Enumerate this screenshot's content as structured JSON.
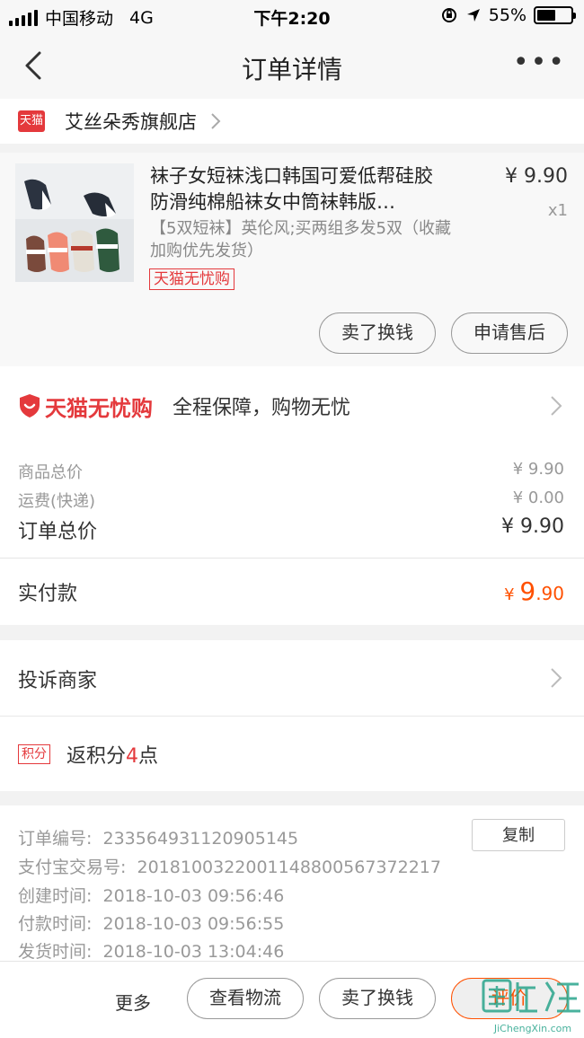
{
  "status_bar": {
    "carrier": "中国移动",
    "network": "4G",
    "time": "下午2:20",
    "battery": "55%"
  },
  "header": {
    "title": "订单详情"
  },
  "store": {
    "badge": "天猫",
    "name": "艾丝朵秀旗舰店"
  },
  "product": {
    "title": "袜子女短袜浅口韩国可爱低帮硅胶防滑纯棉船袜女中筒袜韩版…",
    "price": "¥ 9.90",
    "quantity": "x1",
    "sku": "【5双短袜】英伦风;买两组多发5双（收藏加购优先发货）",
    "tag": "天猫无忧购",
    "buttons": {
      "sell": "卖了换钱",
      "after_sale": "申请售后"
    }
  },
  "guarantee": {
    "logo_text": "天猫无忧购",
    "text": "全程保障，购物无忧"
  },
  "summary": {
    "goods_total_label": "商品总价",
    "goods_total": "¥ 9.90",
    "shipping_label": "运费(快递)",
    "shipping": "¥ 0.00",
    "order_total_label": "订单总价",
    "order_total": "¥ 9.90",
    "paid_label": "实付款",
    "paid_currency": "¥ ",
    "paid_int": "9",
    "paid_dec": ".90"
  },
  "complain": {
    "label": "投诉商家"
  },
  "points": {
    "badge": "积分",
    "prefix": "返积分",
    "count": "4",
    "suffix": "点"
  },
  "order_info": {
    "order_no_label": "订单编号:",
    "order_no": "233564931120905145",
    "copy_label": "复制",
    "alipay_label": "支付宝交易号:",
    "alipay_no": "2018100322001148800567372217",
    "created_label": "创建时间:",
    "created": "2018-10-03 09:56:46",
    "paid_time_label": "付款时间:",
    "paid_time": "2018-10-03 09:56:55",
    "shipped_label": "发货时间:",
    "shipped": "2018-10-03 13:04:46"
  },
  "bottom_bar": {
    "more": "更多",
    "logistics": "查看物流",
    "sell": "卖了换钱",
    "review": "评价"
  },
  "watermark": {
    "text": "JiChengXin.com"
  },
  "colors": {
    "tmall_red": "#e4393c",
    "price_orange": "#ff5000"
  }
}
